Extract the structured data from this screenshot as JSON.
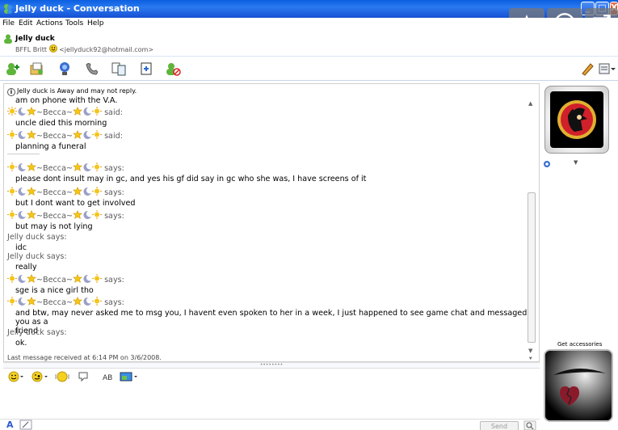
{
  "window": {
    "title": "Jelly duck - Conversation",
    "min_label": "_",
    "max_label": "□",
    "close_label": "X"
  },
  "menu": [
    "File",
    "Edit",
    "Actions",
    "Tools",
    "Help"
  ],
  "contact": {
    "name": "Jelly duck",
    "personal_message": "BFFL Britt",
    "email": "<jellyduck92@hotmail.com>"
  },
  "status_notice": "Jelly duck is Away and may not reply.",
  "chat": {
    "top_cut_line": "am on phone with the V.A.",
    "becca_name": "~Becca~",
    "jelly_name": "Jelly duck",
    "said": "said:",
    "says": "says:",
    "m1": "uncle died this morning",
    "m2": "planning a funeral",
    "m3": "please dont insult may in gc, and yes his gf did say in gc who she was, I have screens of it",
    "m4": "but I dont want to get involved",
    "m5": "but may is not lying",
    "m6": "idc",
    "m7": "really",
    "m8": "sge is a nice girl tho",
    "m9a": "and btw, may never asked me to msg you, I havent even spoken to her in a week, I just happened to see game chat and messaged you as a",
    "m9b": "friend",
    "m10": "ok."
  },
  "last_message": "Last message received at 6:14 PM on 3/6/2008.",
  "send_label": "Send",
  "accessories_label": "Get accessories",
  "colors": {
    "titlebar": "#0a5fe0",
    "accent": "#2b79f0"
  }
}
